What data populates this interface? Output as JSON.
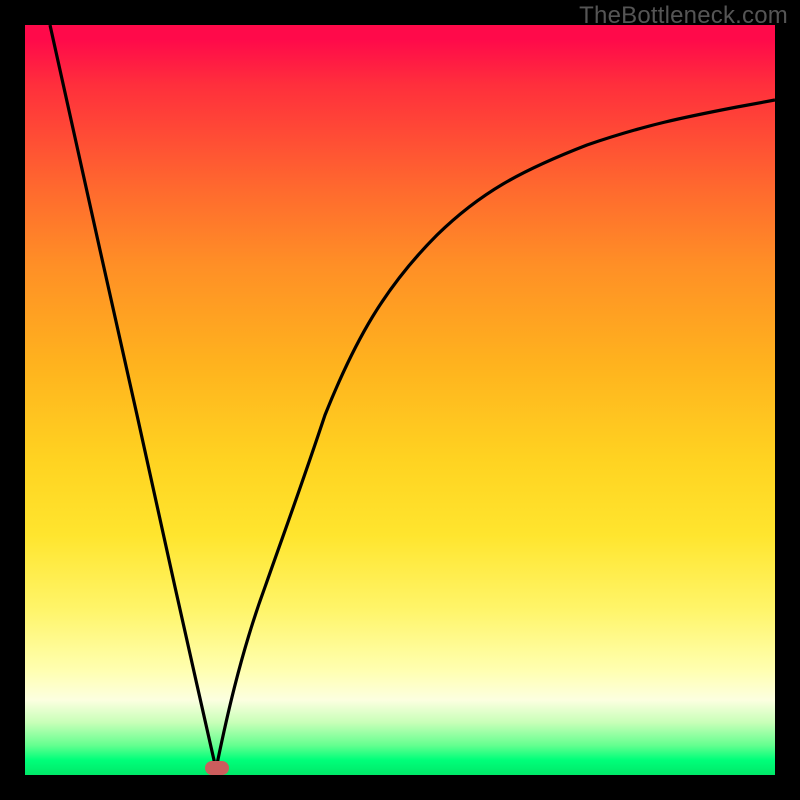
{
  "watermark": "TheBottleneck.com",
  "chart_data": {
    "type": "line",
    "title": "",
    "xlabel": "",
    "ylabel": "",
    "xlim": [
      0,
      100
    ],
    "ylim": [
      0,
      100
    ],
    "grid": false,
    "legend": false,
    "background": "rainbow-gradient-red-to-green",
    "series": [
      {
        "name": "left-branch",
        "x": [
          3.3,
          6,
          10,
          15,
          20,
          23,
          25.5
        ],
        "y": [
          100,
          88,
          70,
          48,
          25,
          12,
          0.8
        ]
      },
      {
        "name": "right-branch",
        "x": [
          25.5,
          28,
          32,
          36,
          40,
          45,
          50,
          55,
          60,
          65,
          70,
          75,
          80,
          85,
          90,
          95,
          100
        ],
        "y": [
          0.8,
          10,
          25,
          38,
          48,
          58,
          65,
          71,
          75.5,
          79,
          82,
          84.3,
          86.2,
          87.7,
          88.8,
          89.6,
          90
        ]
      }
    ],
    "annotations": [
      {
        "name": "min-marker",
        "x": 25.5,
        "y": 0.8,
        "shape": "rounded-rect",
        "color": "#cc5d5d"
      }
    ]
  },
  "colors": {
    "frame": "#000000",
    "curve": "#000000",
    "marker": "#cc5d5d",
    "watermark": "#555555"
  }
}
